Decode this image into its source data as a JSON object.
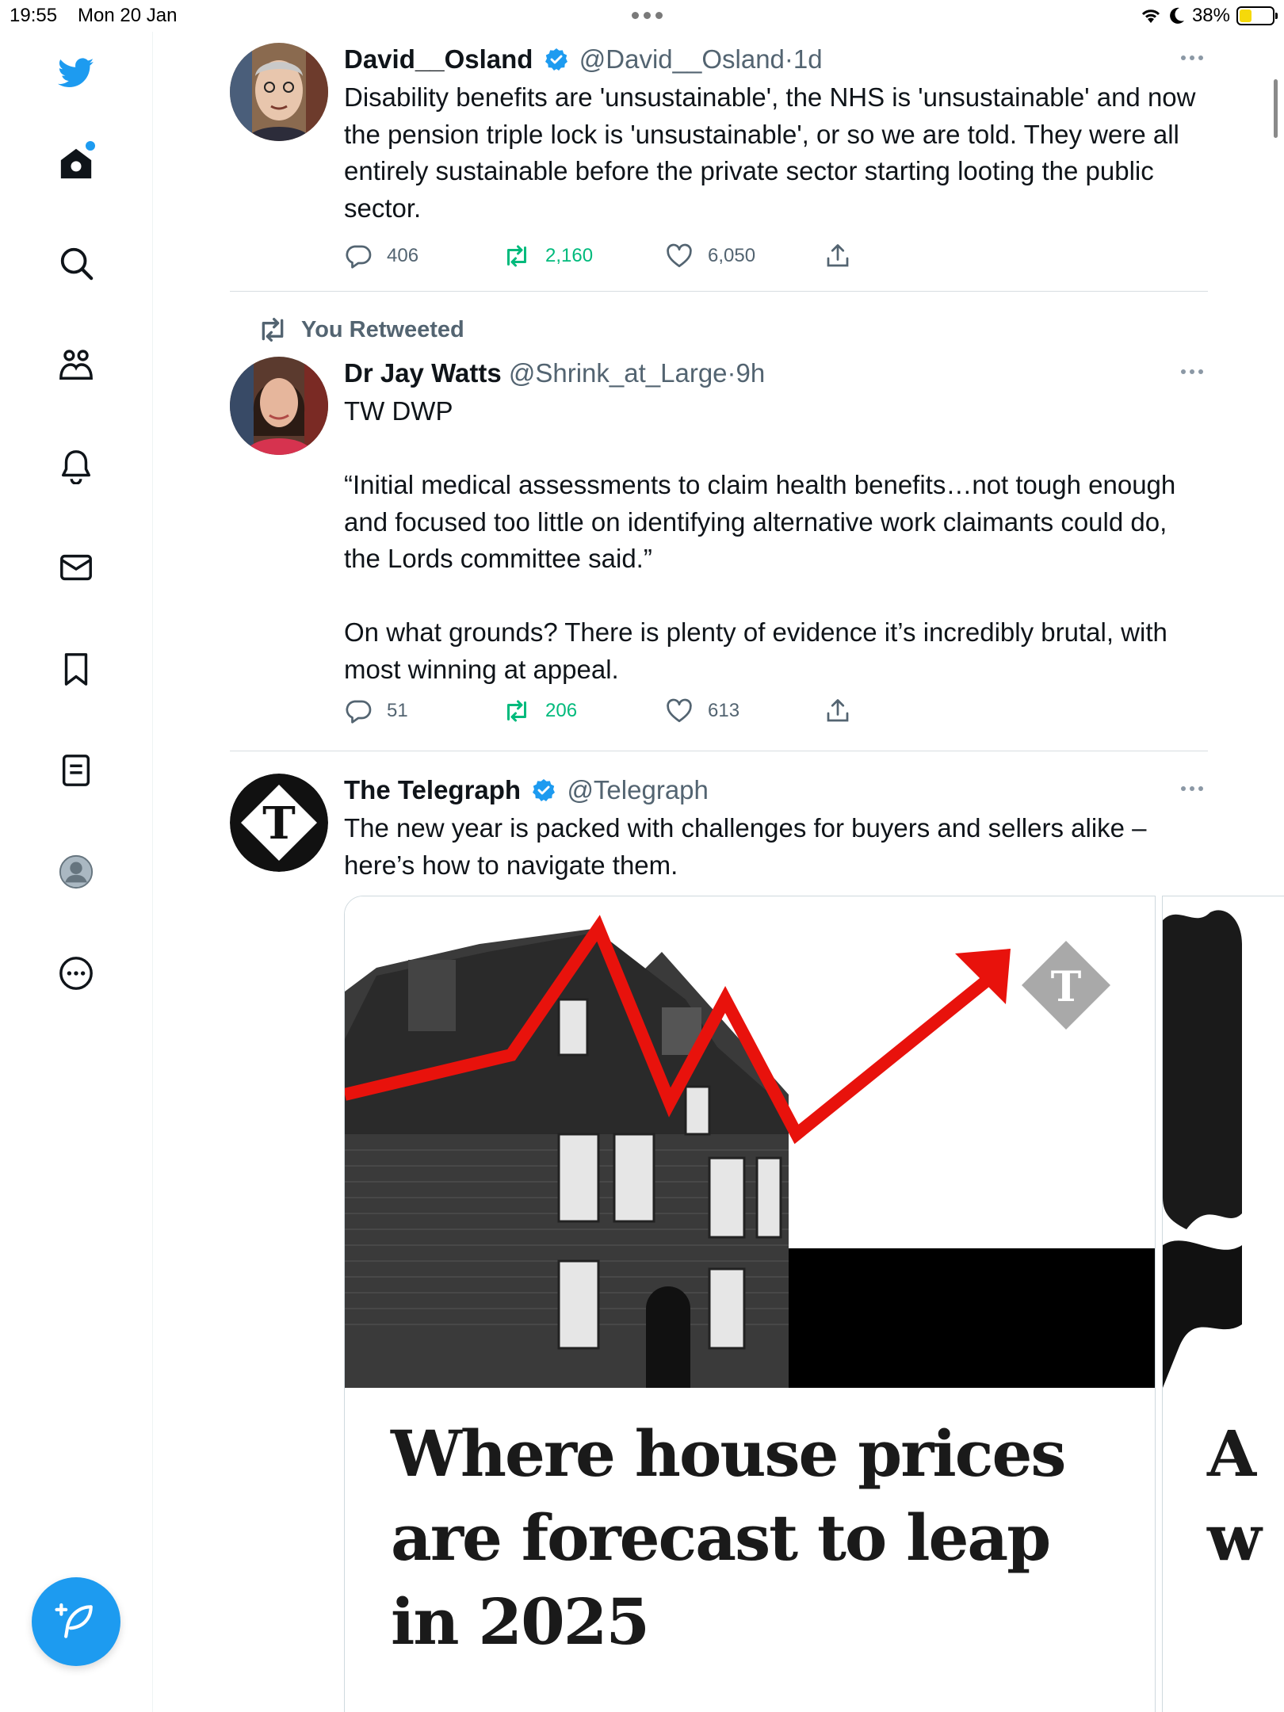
{
  "status_bar": {
    "time": "19:55",
    "date": "Mon 20 Jan",
    "battery": "38%",
    "battery_level": 0.38
  },
  "sidebar": {
    "items": [
      {
        "name": "twitter-logo",
        "icon": "bird-icon"
      },
      {
        "name": "home",
        "icon": "home-icon",
        "has_notification": true
      },
      {
        "name": "explore",
        "icon": "search-icon"
      },
      {
        "name": "communities",
        "icon": "communities-icon"
      },
      {
        "name": "notifications",
        "icon": "bell-icon"
      },
      {
        "name": "messages",
        "icon": "mail-icon"
      },
      {
        "name": "bookmarks",
        "icon": "bookmark-icon"
      },
      {
        "name": "lists",
        "icon": "list-icon"
      },
      {
        "name": "profile",
        "icon": "profile-avatar-icon"
      },
      {
        "name": "more",
        "icon": "more-circle-icon"
      }
    ],
    "compose_icon": "compose-feather-icon",
    "accent_color": "#1d9bf0"
  },
  "tweets": [
    {
      "display_name": "David__Osland",
      "verified": true,
      "handle": "@David__Osland",
      "separator": "·",
      "time": "1d",
      "text": "Disability benefits are 'unsustainable', the NHS is 'unsustainable' and now the pension triple lock is 'unsustainable', or so we are told. They were all entirely sustainable before the private sector starting looting the public sector.",
      "replies": "406",
      "retweets": "2,160",
      "likes": "6,050"
    },
    {
      "retweeted_label": "You Retweeted",
      "display_name": "Dr Jay Watts",
      "verified": false,
      "handle": "@Shrink_at_Large",
      "separator": "·",
      "time": "9h",
      "text": "TW DWP\n\n“Initial medical assessments to claim health benefits…not tough enough and focused too little on identifying alternative work claimants could do, the Lords committee said.”\n\nOn what grounds? There is plenty of evidence it’s incredibly brutal, with most winning at appeal.",
      "replies": "51",
      "retweets": "206",
      "likes": "613"
    },
    {
      "display_name": "The Telegraph",
      "verified": true,
      "handle": "@Telegraph",
      "text": "The new year is packed with challenges for buyers and sellers alike – here’s how to navigate them.",
      "card_headline": "Where house prices are forecast to leap in 2025",
      "card2_headline": "A\nw"
    }
  ],
  "colors": {
    "retweet_green": "#00ba7c",
    "secondary_text": "#536471",
    "verified_blue": "#1d9bf0"
  }
}
